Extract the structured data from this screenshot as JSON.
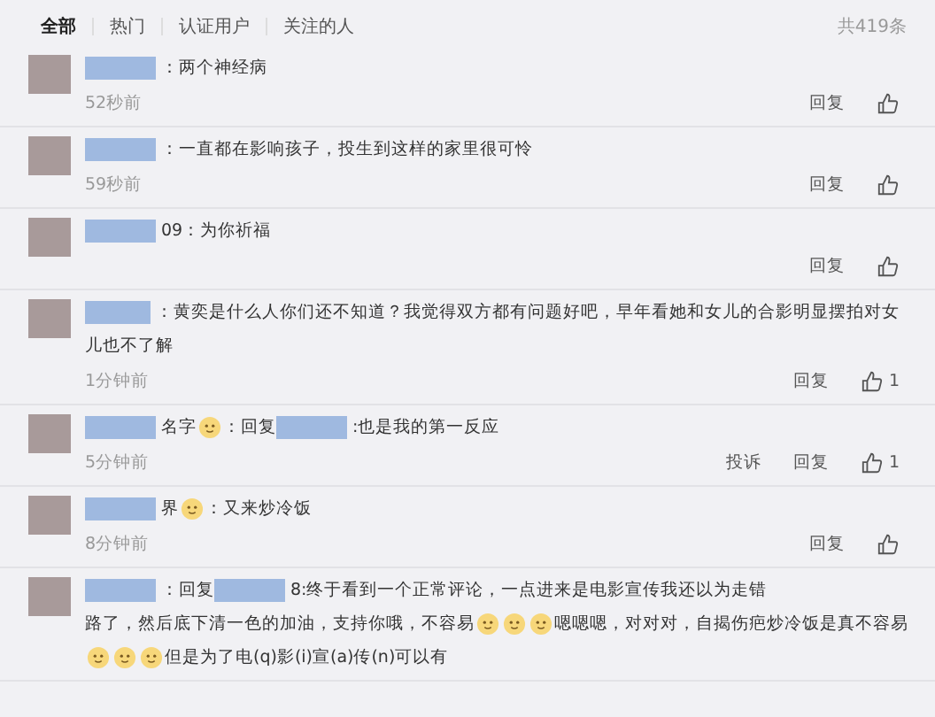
{
  "tabs": [
    {
      "label": "全部",
      "selected": true
    },
    {
      "label": "热门",
      "selected": false
    },
    {
      "label": "认证用户",
      "selected": false
    },
    {
      "label": "关注的人",
      "selected": false
    }
  ],
  "total": "共419条",
  "comments": [
    {
      "lines": [
        [
          {
            "kind": "blur"
          },
          {
            "kind": "text",
            "text": "：两个神经病"
          }
        ]
      ],
      "time": "52秒前",
      "actions": [
        "回复"
      ]
    },
    {
      "lines": [
        [
          {
            "kind": "blur"
          },
          {
            "kind": "text",
            "text": "：一直都在影响孩子，投生到这样的家里很可怜"
          }
        ]
      ],
      "time": "59秒前",
      "actions": [
        "回复"
      ]
    },
    {
      "lines": [
        [
          {
            "kind": "blur"
          },
          {
            "kind": "text",
            "text": "09：为你祈福"
          }
        ]
      ],
      "actions": [
        "回复"
      ]
    },
    {
      "lines": [
        [
          {
            "kind": "blur"
          },
          {
            "kind": "text",
            "text": "：黄奕是什么人你们还不知道？我觉得双方都有问题好吧，早年看她和女儿的合影明显摆拍对女"
          }
        ],
        [
          {
            "kind": "text",
            "text": "儿也不了解"
          }
        ]
      ],
      "time": "1分钟前",
      "actions": [
        "回复"
      ],
      "likes": "1"
    },
    {
      "lines": [
        [
          {
            "kind": "blur"
          },
          {
            "kind": "text",
            "text": "名字"
          },
          {
            "kind": "emoji"
          },
          {
            "kind": "text",
            "text": "：回复"
          },
          {
            "kind": "blur"
          },
          {
            "kind": "text",
            "text": ":也是我的第一反应"
          }
        ]
      ],
      "time": "5分钟前",
      "actions": [
        "投诉",
        "回复"
      ],
      "likes": "1"
    },
    {
      "lines": [
        [
          {
            "kind": "blur"
          },
          {
            "kind": "text",
            "text": "界"
          },
          {
            "kind": "emoji"
          },
          {
            "kind": "text",
            "text": "：又来炒冷饭"
          }
        ]
      ],
      "time": "8分钟前",
      "actions": [
        "回复"
      ]
    },
    {
      "lines": [
        [
          {
            "kind": "blur"
          },
          {
            "kind": "text",
            "text": "：回复"
          },
          {
            "kind": "blur"
          },
          {
            "kind": "text",
            "text": "8:终于看到一个正常评论，一点进来是电影宣传我还以为走错"
          }
        ],
        [
          {
            "kind": "text",
            "text": "路了，然后底下清一色的加油，支持你哦，不容易"
          },
          {
            "kind": "emoji"
          },
          {
            "kind": "emoji"
          },
          {
            "kind": "emoji"
          },
          {
            "kind": "text",
            "text": "嗯嗯嗯，对对对，自揭伤疤炒冷饭是真不容易"
          }
        ],
        [
          {
            "kind": "emoji"
          },
          {
            "kind": "emoji"
          },
          {
            "kind": "emoji"
          },
          {
            "kind": "text",
            "text": "但是为了电(q)影(i)宣(a)传(n)可以有"
          }
        ]
      ]
    }
  ]
}
